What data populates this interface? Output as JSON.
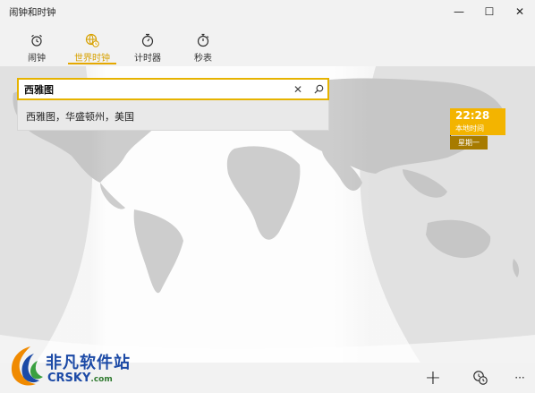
{
  "window": {
    "title": "闹钟和时钟",
    "minimize": "—",
    "maximize": "☐",
    "close": "✕"
  },
  "tabs": [
    {
      "label": "闹钟",
      "icon": "alarm-icon",
      "active": false
    },
    {
      "label": "世界时钟",
      "icon": "world-clock-icon",
      "active": true
    },
    {
      "label": "计时器",
      "icon": "timer-icon",
      "active": false
    },
    {
      "label": "秒表",
      "icon": "stopwatch-icon",
      "active": false
    }
  ],
  "search": {
    "value": "西雅图",
    "clear_glyph": "✕",
    "icon": "search-icon"
  },
  "suggestion": {
    "text": "西雅图，华盛顿州，美国"
  },
  "local_clock": {
    "time": "22:28",
    "label": "本地时间",
    "day": "星期一"
  },
  "commands": {
    "add": "+",
    "compare": "compare-clocks-icon",
    "more": "···"
  },
  "watermark": {
    "name": "非凡软件站",
    "domain": "CRSKY",
    "suffix": ".com"
  },
  "colors": {
    "accent": "#e5a800",
    "clock_card": "#f3b400",
    "clock_day": "#a77b00"
  }
}
